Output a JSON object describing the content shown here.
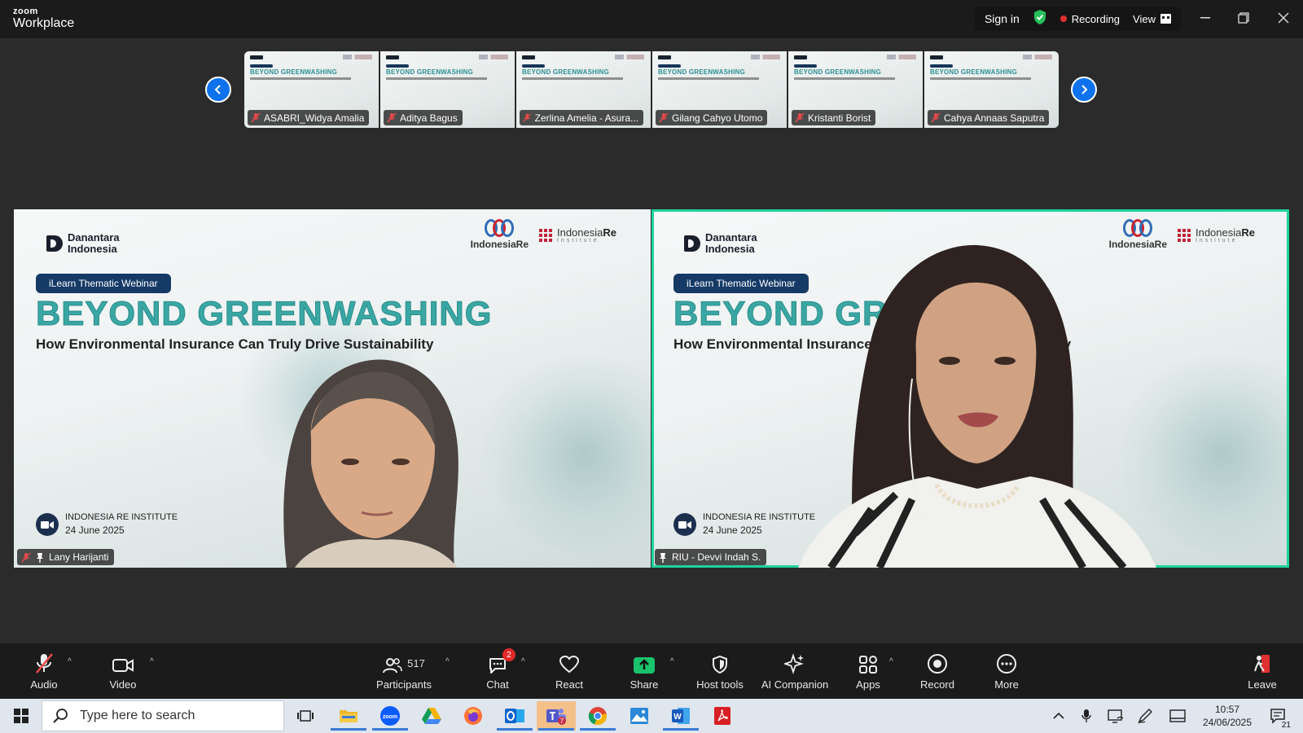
{
  "app": {
    "brand_small": "zoom",
    "brand_large": "Workplace"
  },
  "titlebar": {
    "sign_in": "Sign in",
    "recording": "Recording",
    "view": "View"
  },
  "thumbnails": [
    {
      "name": "ASABRI_Widya Amalia"
    },
    {
      "name": "Aditya Bagus"
    },
    {
      "name": "Zerlina Amelia - Asura..."
    },
    {
      "name": "Gilang Cahyo Utomo"
    },
    {
      "name": "Kristanti Borist"
    },
    {
      "name": "Cahya Annaas Saputra"
    }
  ],
  "thumb_slide": {
    "title": "BEYOND GREENWASHING"
  },
  "slide": {
    "pill": "iLearn Thematic Webinar",
    "title": "BEYOND GREENWASHING",
    "subtitle": "How Environmental Insurance Can Truly Drive Sustainability",
    "subtitle_partial_left": "How Environmental Insurance",
    "subtitle_partial_right": "ty",
    "title_partial_left": "BEYOND GREE",
    "title_partial_right": "G",
    "danantara_line1": "Danantara",
    "danantara_line2": "Indonesia",
    "indonesia_re": "IndonesiaRe",
    "iri_name_a": "Indonesia",
    "iri_name_b": "Re",
    "iri_sub": "Institute",
    "institute": "INDONESIA RE INSTITUTE",
    "date": "24 June 2025"
  },
  "tiles": [
    {
      "name": "Lany Harijanti"
    },
    {
      "name": "RIU - Devvi Indah S."
    }
  ],
  "toolbar": {
    "audio": "Audio",
    "video": "Video",
    "participants": "Participants",
    "participants_count": "517",
    "chat": "Chat",
    "chat_badge": "2",
    "react": "React",
    "share": "Share",
    "host_tools": "Host tools",
    "ai_companion": "AI Companion",
    "apps": "Apps",
    "record": "Record",
    "more": "More",
    "leave": "Leave"
  },
  "taskbar": {
    "search_placeholder": "Type here to search",
    "time": "10:57",
    "date": "24/06/2025",
    "notifications": "21"
  },
  "colors": {
    "accent": "#0e72ed",
    "active_speaker": "#1fd39b",
    "title_teal": "#3aa7a4",
    "record_red": "#e03030"
  }
}
